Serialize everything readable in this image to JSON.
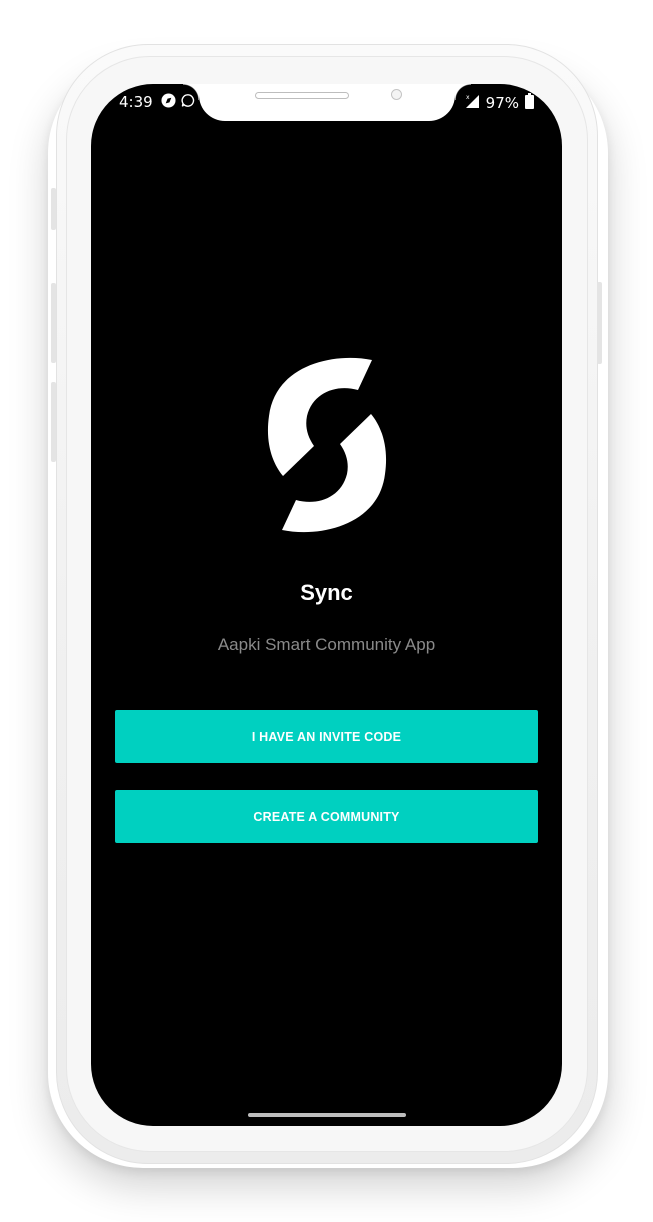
{
  "status_bar": {
    "time": "4:39",
    "battery": "97%",
    "left_icons": [
      "navigation-icon",
      "whatsapp-icon"
    ],
    "right_icons": [
      "signal-icon",
      "battery-icon"
    ]
  },
  "app": {
    "logo_icon": "sync-logo-icon",
    "name": "Sync",
    "tagline": "Aapki Smart Community App"
  },
  "actions": {
    "invite_label": "I HAVE AN INVITE CODE",
    "create_label": "CREATE A COMMUNITY"
  },
  "colors": {
    "background": "#000000",
    "accent": "#00D0C0",
    "tagline": "#8A8A8A"
  }
}
